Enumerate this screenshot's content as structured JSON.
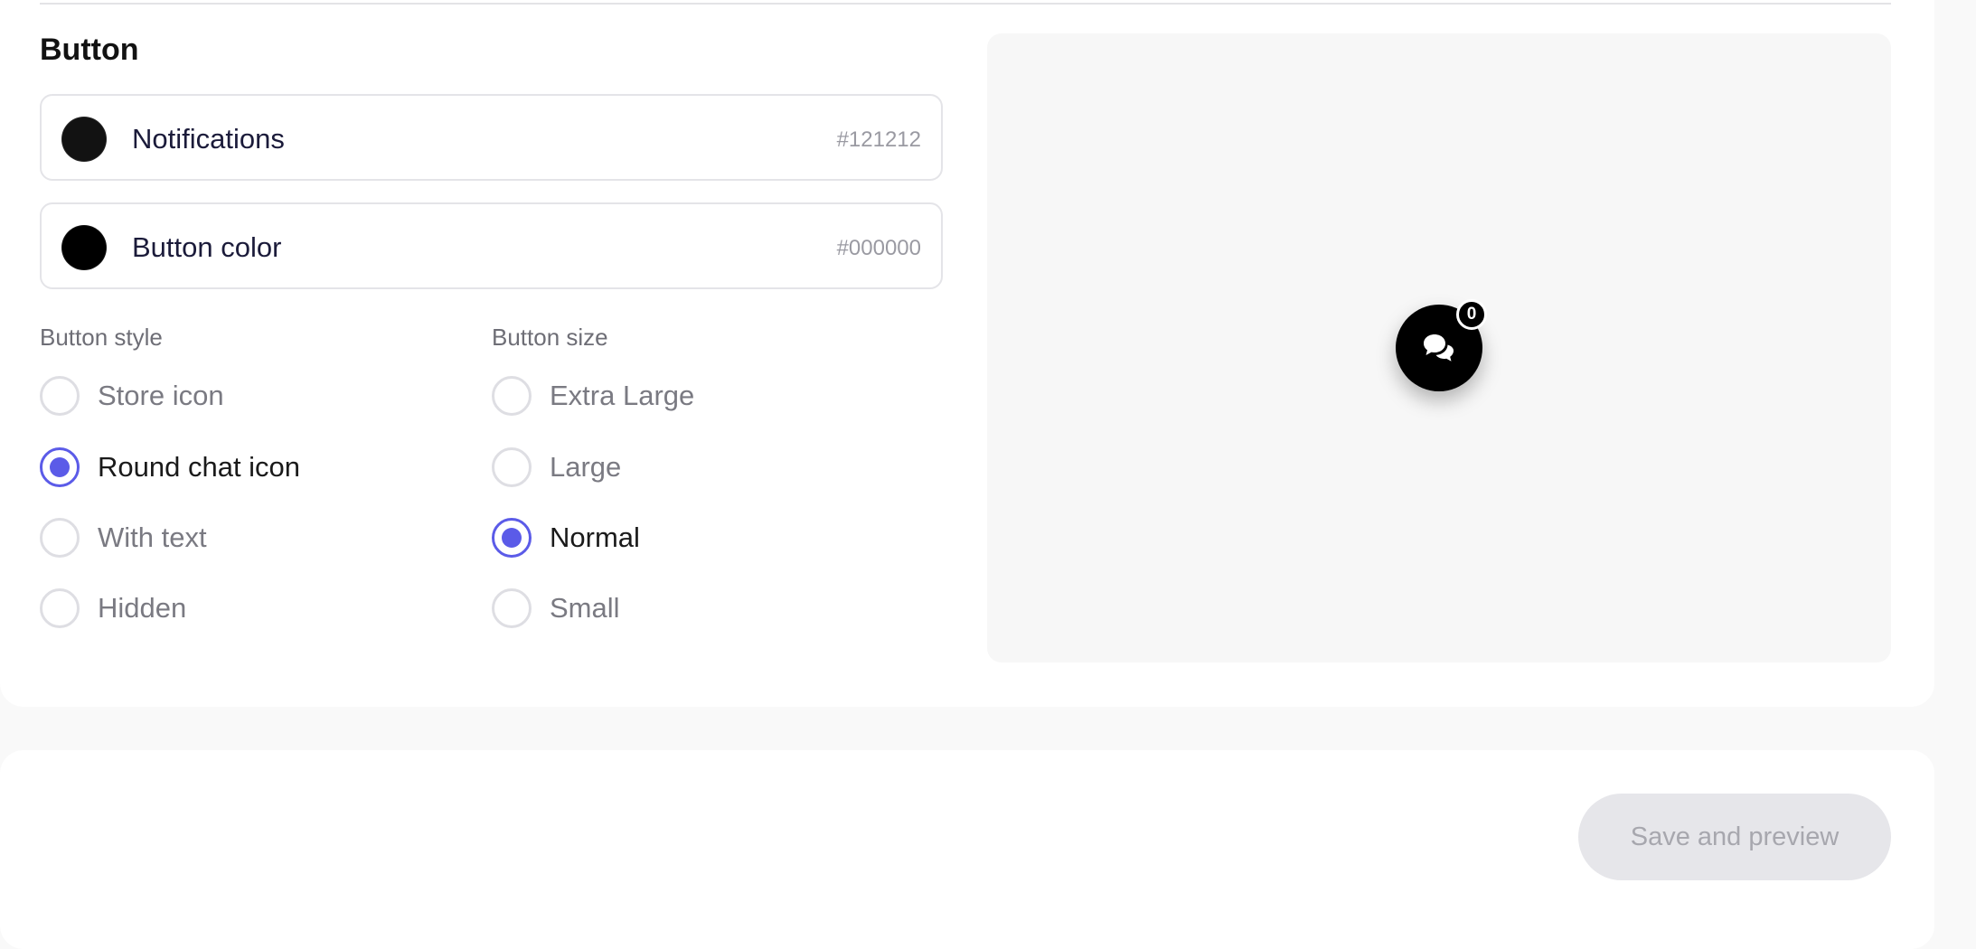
{
  "section": {
    "title": "Button"
  },
  "colors": [
    {
      "label": "Notifications",
      "hex": "#121212",
      "swatch": "#121212"
    },
    {
      "label": "Button color",
      "hex": "#000000",
      "swatch": "#000000"
    }
  ],
  "button_style": {
    "label": "Button style",
    "options": [
      "Store icon",
      "Round chat icon",
      "With text",
      "Hidden"
    ],
    "selected": "Round chat icon"
  },
  "button_size": {
    "label": "Button size",
    "options": [
      "Extra Large",
      "Large",
      "Normal",
      "Small"
    ],
    "selected": "Normal"
  },
  "preview": {
    "badge_count": "0",
    "icon": "chat-bubbles-icon"
  },
  "footer": {
    "save_label": "Save and preview"
  },
  "theme": {
    "accent": "#5b5be8",
    "disabled_bg": "#e6e6ea",
    "disabled_text": "#a7a7ae"
  }
}
